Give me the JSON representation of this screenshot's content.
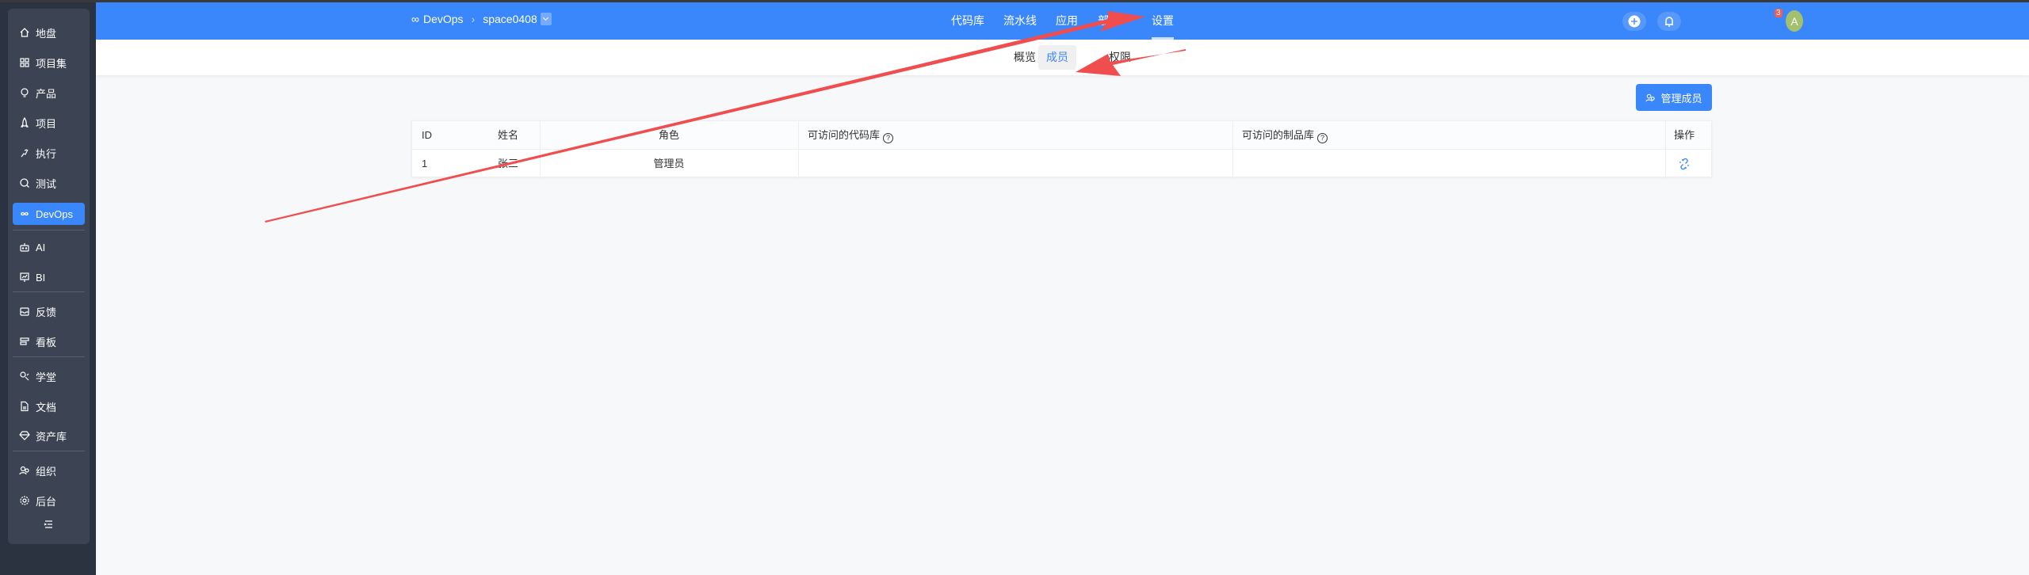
{
  "sidebar": {
    "items": [
      {
        "label": "地盘",
        "icon": "home-icon"
      },
      {
        "label": "项目集",
        "icon": "grid-icon"
      },
      {
        "label": "产品",
        "icon": "lightbulb-icon"
      },
      {
        "label": "项目",
        "icon": "rocket-icon"
      },
      {
        "label": "执行",
        "icon": "run-icon"
      },
      {
        "label": "测试",
        "icon": "search-icon"
      },
      {
        "label": "DevOps",
        "icon": "infinity-icon"
      },
      {
        "label": "AI",
        "icon": "robot-icon"
      },
      {
        "label": "BI",
        "icon": "chart-board-icon"
      },
      {
        "label": "反馈",
        "icon": "inbox-icon"
      },
      {
        "label": "看板",
        "icon": "kanban-icon"
      },
      {
        "label": "学堂",
        "icon": "school-icon"
      },
      {
        "label": "文档",
        "icon": "document-icon"
      },
      {
        "label": "资产库",
        "icon": "diamond-icon"
      },
      {
        "label": "组织",
        "icon": "people-icon"
      },
      {
        "label": "后台",
        "icon": "gear-icon"
      }
    ],
    "active": "DevOps",
    "collapse_icon": "collapse-icon"
  },
  "header": {
    "breadcrumb": {
      "root": "DevOps",
      "space": "space0408"
    },
    "nav": [
      "代码库",
      "流水线",
      "应用",
      "部署",
      "设置"
    ],
    "active_nav": "设置",
    "notification_count": "3",
    "avatar_letter": "A"
  },
  "subnav": {
    "tabs": [
      "概览",
      "成员",
      "权限"
    ],
    "active": "成员"
  },
  "toolbar": {
    "manage_members": "管理成员"
  },
  "table": {
    "columns": [
      "ID",
      "姓名",
      "角色",
      "可访问的代码库",
      "可访问的制品库",
      "操作"
    ],
    "rows": [
      {
        "id": "1",
        "name": "张三",
        "role": "管理员",
        "repos": "",
        "artifacts": ""
      }
    ]
  },
  "colors": {
    "primary": "#3a86fb",
    "sidebar": "#2c3340",
    "avatar": "#a3c06d",
    "annotation": "#f04e4e"
  }
}
